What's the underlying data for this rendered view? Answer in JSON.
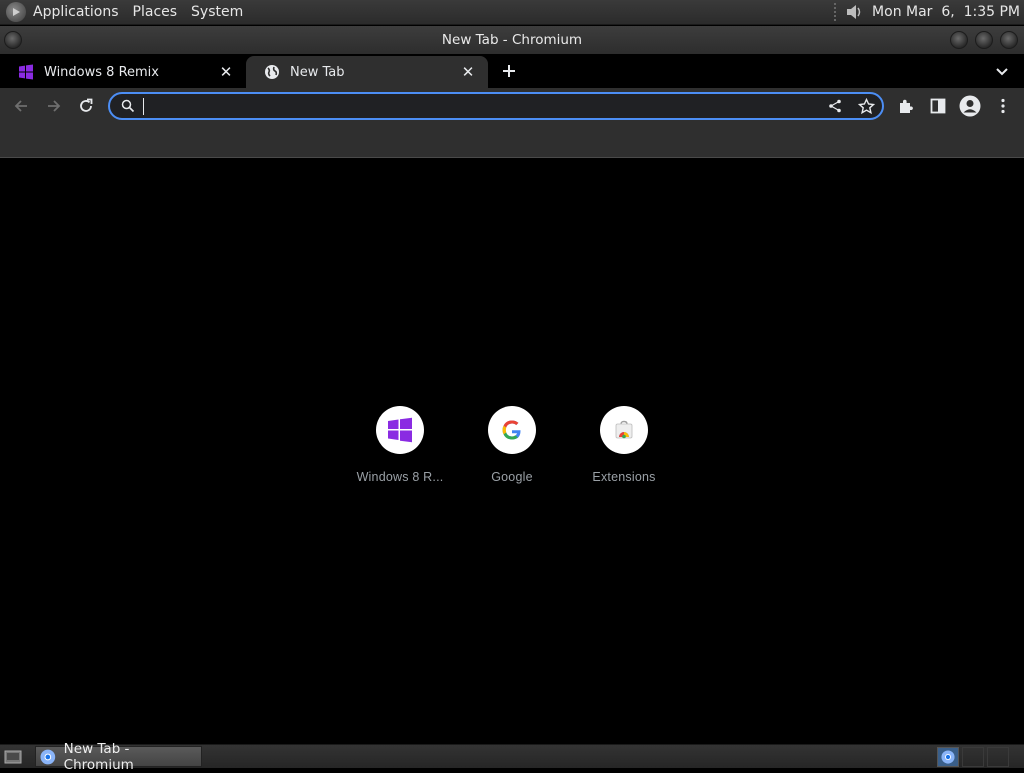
{
  "top_panel": {
    "menus": [
      "Applications",
      "Places",
      "System"
    ],
    "clock": "Mon Mar  6,  1:35 PM"
  },
  "window": {
    "title": "New Tab - Chromium"
  },
  "tabs": [
    {
      "title": "Windows 8 Remix",
      "favicon": "windows-logo-icon",
      "active": false
    },
    {
      "title": "New Tab",
      "favicon": "globe-icon",
      "active": true
    }
  ],
  "toolbar": {
    "omnibox_value": ""
  },
  "shortcuts": [
    {
      "label": "Windows 8 R...",
      "icon": "windows-logo-icon"
    },
    {
      "label": "Google",
      "icon": "google-g-icon"
    },
    {
      "label": "Extensions",
      "icon": "chrome-web-store-icon"
    }
  ],
  "taskbar": {
    "task_label": "New Tab - Chromium"
  },
  "colors": {
    "accent": "#4c8ef5",
    "windows_purple": "#8a2be2",
    "tab_active_bg": "#2f2f2f"
  }
}
